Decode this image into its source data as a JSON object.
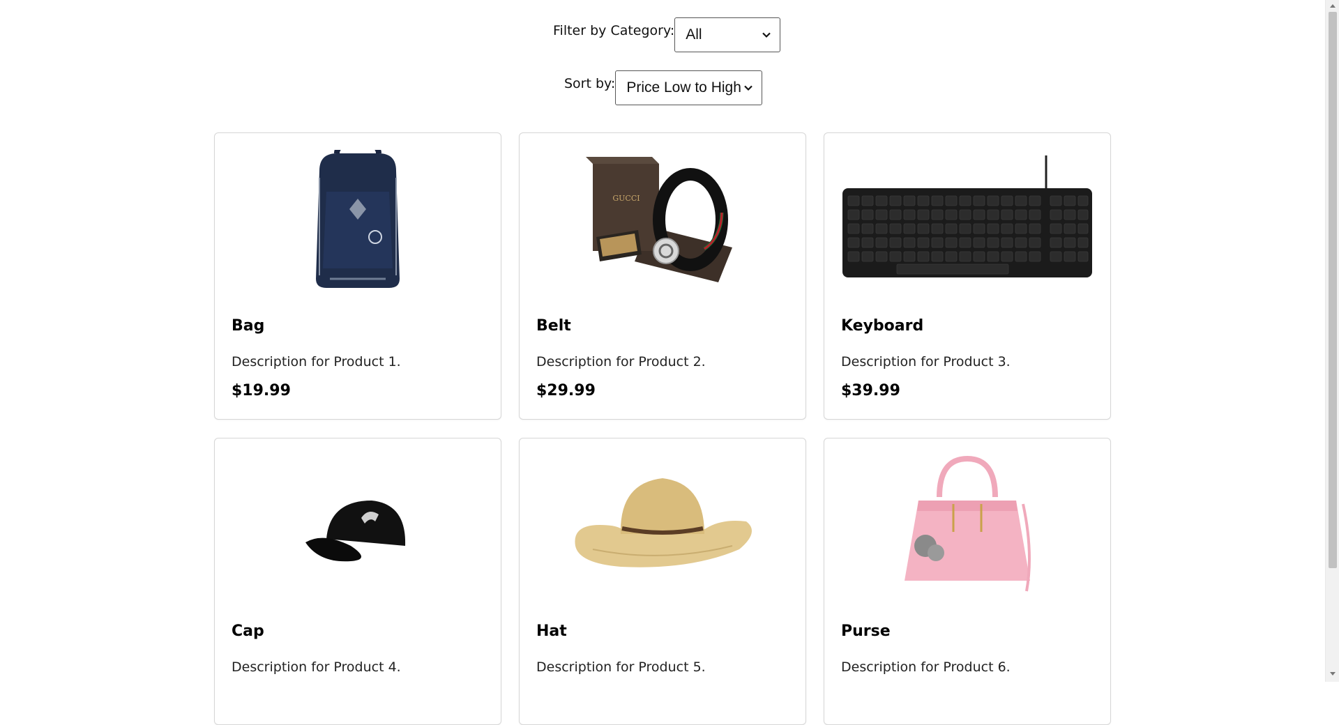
{
  "filters": {
    "category_label": "Filter by Category:",
    "category_value": "All",
    "sort_label": "Sort by:",
    "sort_value": "Price Low to High"
  },
  "products": [
    {
      "name": "Bag",
      "description": "Description for Product 1.",
      "price": "$19.99",
      "image": "backpack"
    },
    {
      "name": "Belt",
      "description": "Description for Product 2.",
      "price": "$29.99",
      "image": "belt"
    },
    {
      "name": "Keyboard",
      "description": "Description for Product 3.",
      "price": "$39.99",
      "image": "keyboard"
    },
    {
      "name": "Cap",
      "description": "Description for Product 4.",
      "price": "",
      "image": "cap"
    },
    {
      "name": "Hat",
      "description": "Description for Product 5.",
      "price": "",
      "image": "straw-hat"
    },
    {
      "name": "Purse",
      "description": "Description for Product 6.",
      "price": "",
      "image": "handbag"
    }
  ],
  "colors": {
    "card_border": "#d6d6d6",
    "text": "#000000",
    "scrollbar_thumb": "#c1c1c1"
  }
}
